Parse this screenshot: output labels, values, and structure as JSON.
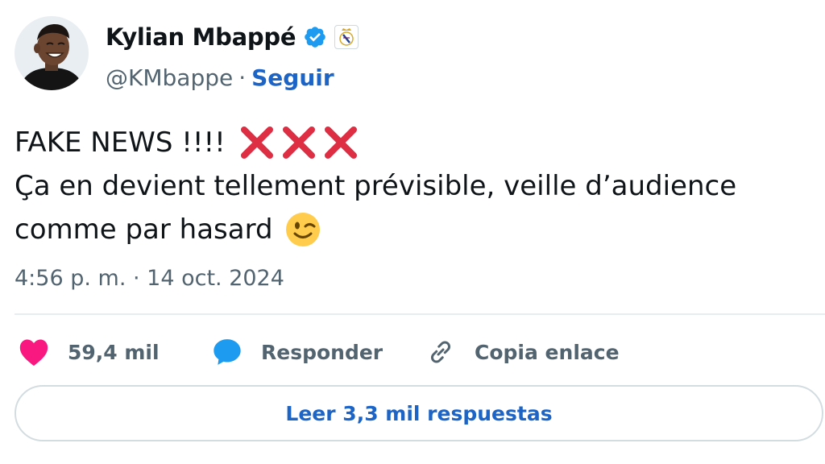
{
  "author": {
    "name": "Kylian Mbappé",
    "handle": "@KMbappe",
    "separator": "·",
    "follow_label": "Seguir",
    "verified_icon": "verified-badge-icon",
    "affiliation_icon": "real-madrid-crest-icon"
  },
  "tweet": {
    "line1": "FAKE NEWS !!!!",
    "line1_emoji": [
      "cross-mark",
      "cross-mark",
      "cross-mark"
    ],
    "line2": "Ça en devient tellement prévisible, veille d’audience",
    "line3": "comme par hasard",
    "line3_emoji": "winking-face",
    "timestamp": "4:56 p. m. · 14 oct. 2024"
  },
  "actions": {
    "likes_count": "59,4 mil",
    "reply_label": "Responder",
    "copy_label": "Copia enlace"
  },
  "read_replies_label": "Leer 3,3 mil respuestas",
  "colors": {
    "link": "#1d64c7",
    "muted": "#536471",
    "heart": "#f91880",
    "bubble": "#1d9bf0",
    "verified": "#1d9bf0",
    "cross": "#dd2e44"
  }
}
